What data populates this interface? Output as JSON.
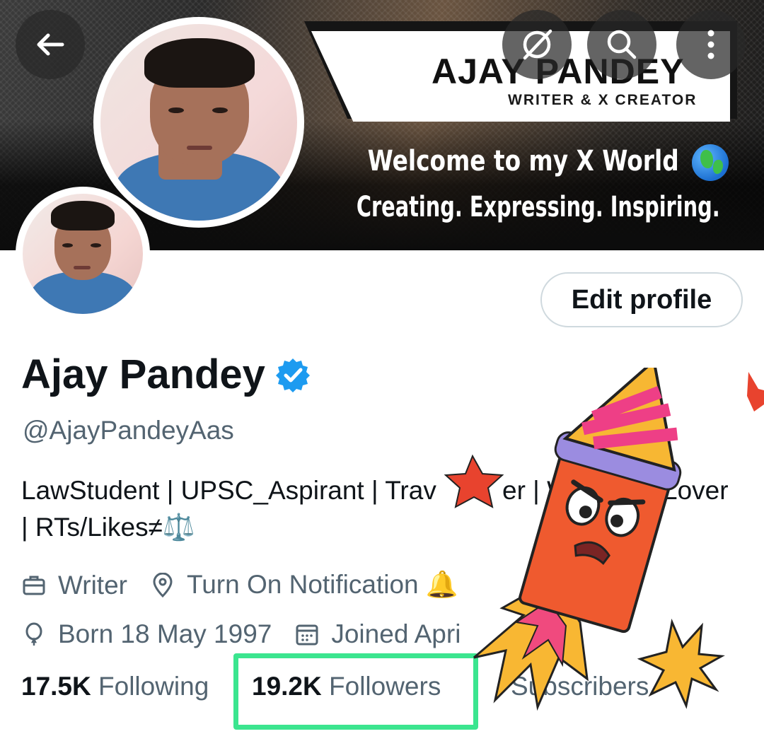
{
  "header": {
    "back_icon": "arrow-left-icon",
    "actions": [
      {
        "name": "grok-icon"
      },
      {
        "name": "search-icon"
      },
      {
        "name": "more-vertical-icon"
      }
    ]
  },
  "banner": {
    "title": "AJAY PANDEY",
    "subtitle": "WRITER & X CREATOR",
    "welcome": "Welcome to my X World",
    "tagline": "Creating. Expressing. Inspiring.",
    "globe_icon": "globe-icon"
  },
  "profile": {
    "edit_button": "Edit profile",
    "name": "Ajay Pandey",
    "verified_icon": "verified-badge-icon",
    "handle": "@AjayPandeyAas",
    "bio_line1": "LawStudent | UPSC_Aspirant | Trav",
    "bio_line1_mid": "er | W",
    "bio_line1_end": "Lover",
    "bio_line2": "| RTs/Likes≠⚖️",
    "meta": {
      "category": "Writer",
      "location": "Turn On Notification 🔔",
      "birth": "Born 18 May 1997",
      "joined": "Joined Apri"
    },
    "stats": {
      "following_count": "17.5K",
      "following_label": "Following",
      "followers_count": "19.2K",
      "followers_label": "Followers",
      "subscribers_label": "Subscribers"
    }
  },
  "colors": {
    "accent_verified": "#1d9bf0",
    "highlight_box": "#3be58f",
    "secondary_text": "#536471"
  }
}
